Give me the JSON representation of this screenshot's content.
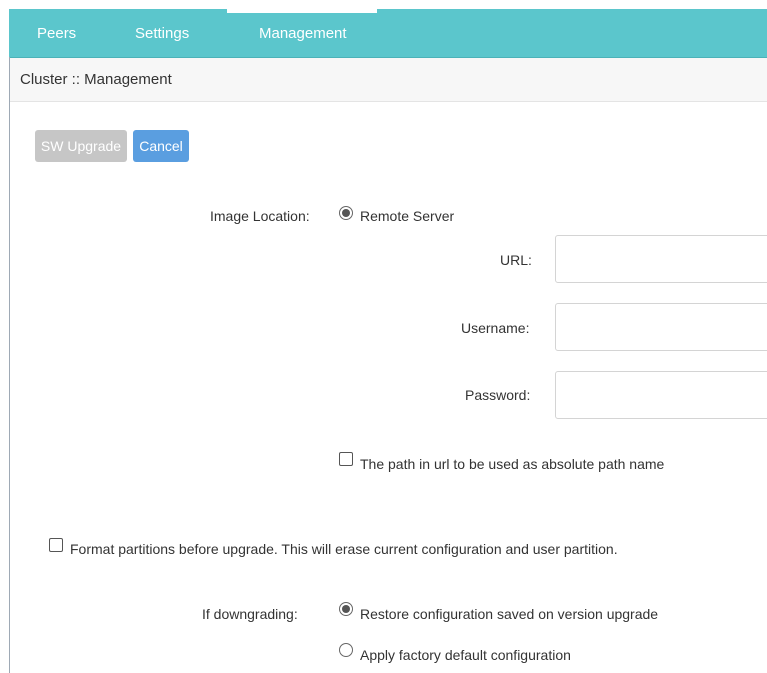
{
  "tabs": [
    {
      "label": "Peers"
    },
    {
      "label": "Settings"
    },
    {
      "label": "Management",
      "active": true
    }
  ],
  "breadcrumb": "Cluster :: Management",
  "buttons": {
    "sw_upgrade": "SW Upgrade",
    "cancel": "Cancel"
  },
  "form": {
    "image_location_label": "Image Location:",
    "image_location_option": "Remote Server",
    "url_label": "URL:",
    "url_value": "",
    "username_label": "Username:",
    "username_value": "",
    "password_label": "Password:",
    "password_value": "",
    "absolute_path_label": "The path in url to be used as absolute path name",
    "format_partitions_label": "Format partitions before upgrade. This will erase current configuration and user partition.",
    "downgrade_label": "If downgrading:",
    "downgrade_options": [
      {
        "label": "Restore configuration saved on version upgrade",
        "selected": true
      },
      {
        "label": "Apply factory default configuration",
        "selected": false
      }
    ]
  },
  "colors": {
    "tab_bar": "#5bc6cc",
    "cancel_button": "#5a9ee0",
    "upgrade_button_disabled": "#c6c6c6"
  }
}
